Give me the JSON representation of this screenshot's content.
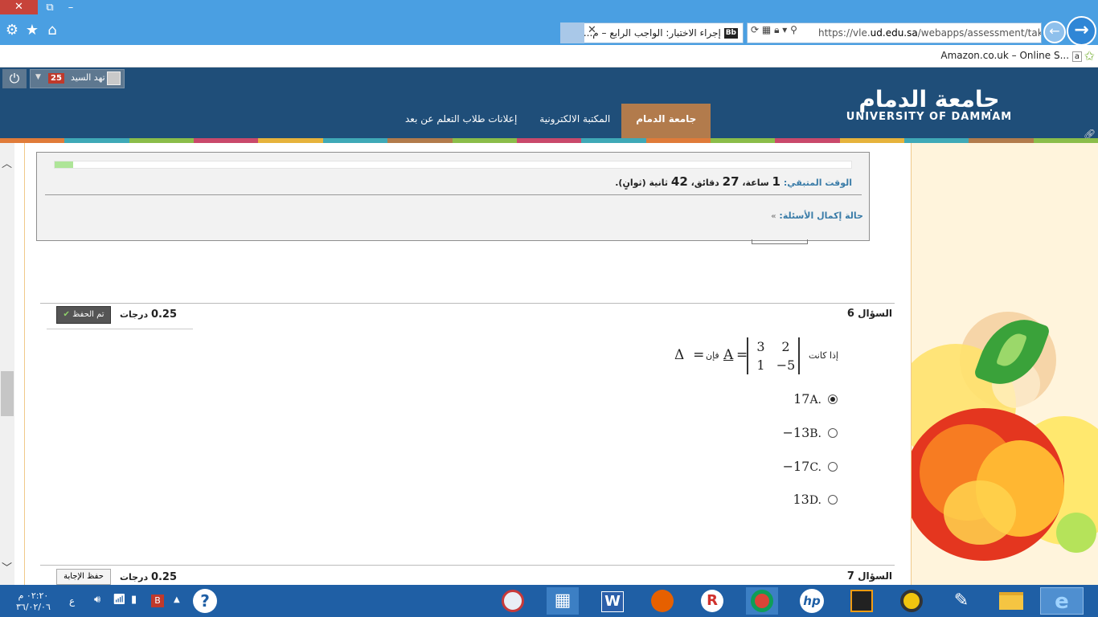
{
  "browser": {
    "tab_title": "إجراء الاختبار: الواجب الرابع – م...",
    "url_prefix": "https://vle.",
    "url_domain": "ud.edu.sa",
    "url_path": "/webapps/assessment/take",
    "favorites_item": "Amazon.co.uk – Online S..."
  },
  "site": {
    "user_name": "تهد السيد",
    "notifications": "25",
    "logo_arabic": "جامعة الدمام",
    "logo_english": "UNIVERSITY OF DAMMAM",
    "tabs": [
      {
        "label": "جامعة الدمام",
        "active": true
      },
      {
        "label": "المكتبة الالكترونية",
        "active": false
      },
      {
        "label": "إعلانات طلاب التعلم عن بعد",
        "active": false
      }
    ]
  },
  "timer": {
    "label": "الوقت المتبقي:",
    "hours": "1",
    "hours_unit": "ساعة،",
    "minutes": "27",
    "minutes_unit": "دقائق،",
    "seconds": "42",
    "seconds_unit": "ثانية (ثوانٍ).",
    "progress": 0.023,
    "status_label": "حالة إكمال الأسئلة:"
  },
  "questions": [
    {
      "label": "السؤال",
      "number": "6",
      "points": "0.25",
      "points_unit": "درجات",
      "save_label": "تم الحفظ",
      "prompt_if": "إذا كانت",
      "prompt_then": "فإن",
      "matrix_name": "A",
      "matrix": [
        [
          "2",
          "3"
        ],
        [
          "−5",
          "1"
        ]
      ],
      "result_symbol": "Δ",
      "options": [
        {
          "letter": "A.",
          "value": "17",
          "selected": true
        },
        {
          "letter": "B.",
          "value": "−13",
          "selected": false
        },
        {
          "letter": "C.",
          "value": "−17",
          "selected": false
        },
        {
          "letter": "D.",
          "value": "13",
          "selected": false
        }
      ]
    },
    {
      "label": "السؤال",
      "number": "7",
      "points": "0.25",
      "points_unit": "درجات",
      "save_label": "حفظ الإجابة"
    }
  ],
  "taskbar": {
    "time": "٠٢:٢٠ م",
    "date": "٣٦/٠٢/٠٦",
    "lang": "ع"
  }
}
